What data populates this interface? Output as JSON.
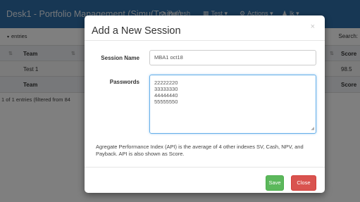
{
  "navbar": {
    "brand": "Desk1 - Portfolio Management (Simu(Train+)",
    "refresh_label": "Refresh",
    "test_label": "Test",
    "actions_label": "Actions",
    "user_label": "lk",
    "colors": {
      "bar": "#2f6fa8"
    }
  },
  "table_controls": {
    "entries_label": "entries",
    "search_label": "Search:"
  },
  "table": {
    "columns": [
      "Team",
      "Score"
    ],
    "rows": [
      {
        "team": "Test 1",
        "score": "98.5"
      }
    ],
    "footer": [
      "Team",
      "Score"
    ],
    "info": "1 of 1 entries (filtered from 84"
  },
  "modal": {
    "title": "Add a New Session",
    "close_symbol": "×",
    "session_name_label": "Session Name",
    "session_name_value": "MBA1 oct18",
    "passwords_label": "Passwords",
    "passwords": [
      "22222220",
      "33333330",
      "44444440",
      "55555550"
    ],
    "description": "Agregate Performance Index (API) is the average of 4 other indexes SV, Cash, NPV, and Payback. API is also shown as Score.",
    "save_label": "Save",
    "close_label": "Close",
    "colors": {
      "save": "#5cb85c",
      "close": "#d9534f"
    }
  }
}
